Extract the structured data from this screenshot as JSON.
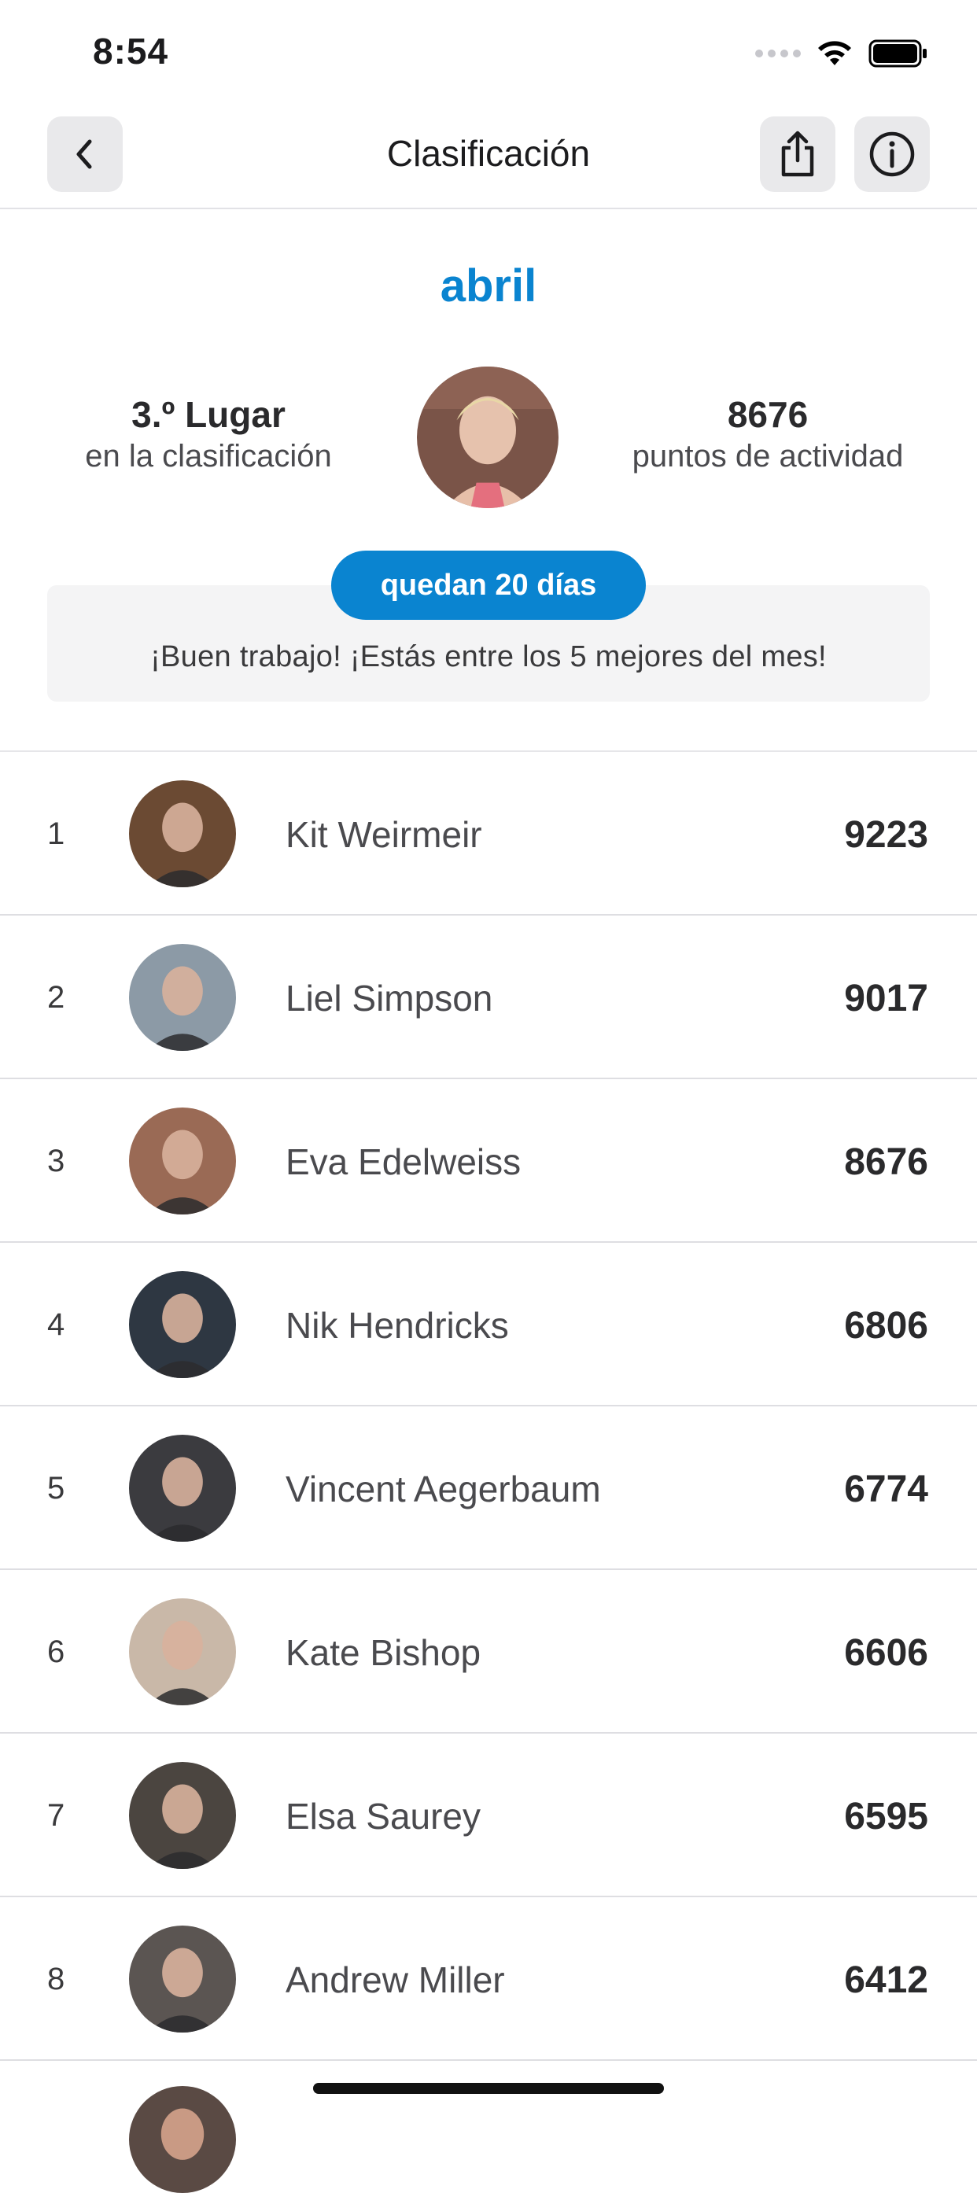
{
  "status_bar": {
    "time": "8:54"
  },
  "nav": {
    "title": "Clasificación",
    "back_icon": "chevron-left-icon",
    "share_icon": "share-icon",
    "info_icon": "info-icon"
  },
  "header": {
    "month": "abril",
    "place_value": "3.º Lugar",
    "place_label": "en la clasificación",
    "points_value": "8676",
    "points_label": "puntos de actividad",
    "days_left": "quedan 20 días",
    "message": "¡Buen trabajo! ¡Estás entre los 5 mejores del mes!"
  },
  "leaderboard": [
    {
      "rank": "1",
      "name": "Kit Weirmeir",
      "points": "9223",
      "tone": "#6b4a33"
    },
    {
      "rank": "2",
      "name": "Liel Simpson",
      "points": "9017",
      "tone": "#8c9aa6"
    },
    {
      "rank": "3",
      "name": "Eva Edelweiss",
      "points": "8676",
      "tone": "#9a6a55"
    },
    {
      "rank": "4",
      "name": "Nik Hendricks",
      "points": "6806",
      "tone": "#2e3742"
    },
    {
      "rank": "5",
      "name": "Vincent Aegerbaum",
      "points": "6774",
      "tone": "#3b3b3f"
    },
    {
      "rank": "6",
      "name": "Kate Bishop",
      "points": "6606",
      "tone": "#c9b8a8"
    },
    {
      "rank": "7",
      "name": "Elsa Saurey",
      "points": "6595",
      "tone": "#4b4540"
    },
    {
      "rank": "8",
      "name": "Andrew Miller",
      "points": "6412",
      "tone": "#5b5552"
    }
  ],
  "colors": {
    "accent": "#0a84d0"
  }
}
